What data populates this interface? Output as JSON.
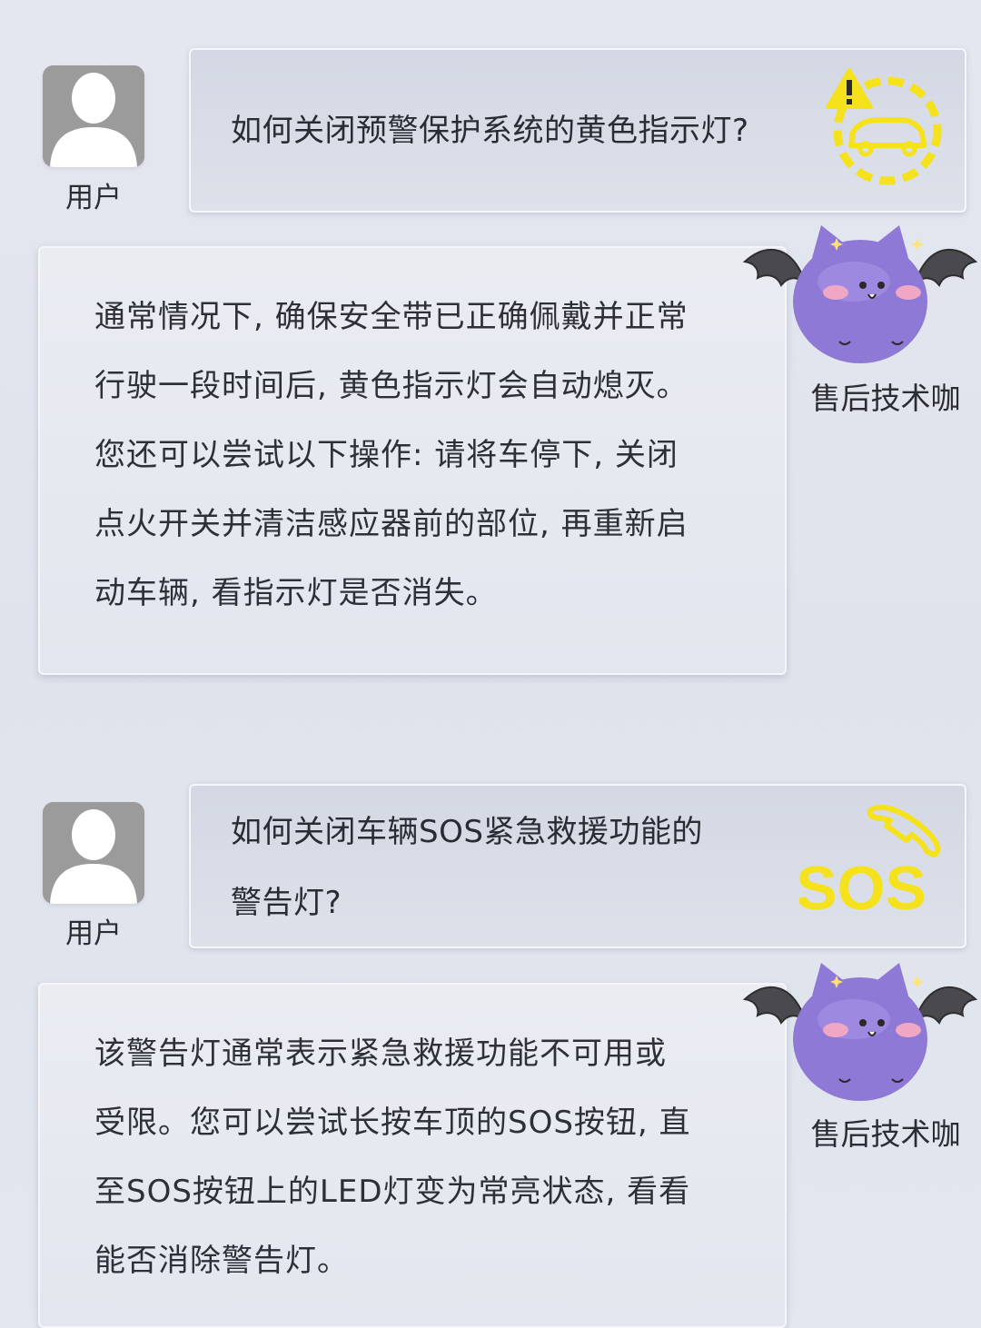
{
  "conversation": [
    {
      "user_label": "用户",
      "question_lines": [
        "如何关闭预警保护系统的黄色指示灯?"
      ],
      "question_icon": "warning-car-indicator-icon",
      "answer_lines": [
        "通常情况下, 确保安全带已正确佩戴并正常",
        "行驶一段时间后, 黄色指示灯会自动熄灭。",
        "您还可以尝试以下操作: 请将车停下, 关闭",
        "点火开关并清洁感应器前的部位, 再重新启",
        "动车辆, 看指示灯是否消失。"
      ],
      "agent_label": "售后技术咖"
    },
    {
      "user_label": "用户",
      "question_lines": [
        "如何关闭车辆SOS紧急救援功能的",
        "警告灯?"
      ],
      "question_icon": "sos-phone-icon",
      "sos_text": "SOS",
      "answer_lines": [
        "该警告灯通常表示紧急救援功能不可用或",
        "受限。您可以尝试长按车顶的SOS按钮, 直",
        "至SOS按钮上的LED灯变为常亮状态, 看看",
        "能否消除警告灯。"
      ],
      "agent_label": "售后技术咖"
    }
  ],
  "colors": {
    "indicator_yellow": "#f5e21c",
    "mascot_purple": "#8f79d6",
    "avatar_gray": "#9b9b9b"
  }
}
